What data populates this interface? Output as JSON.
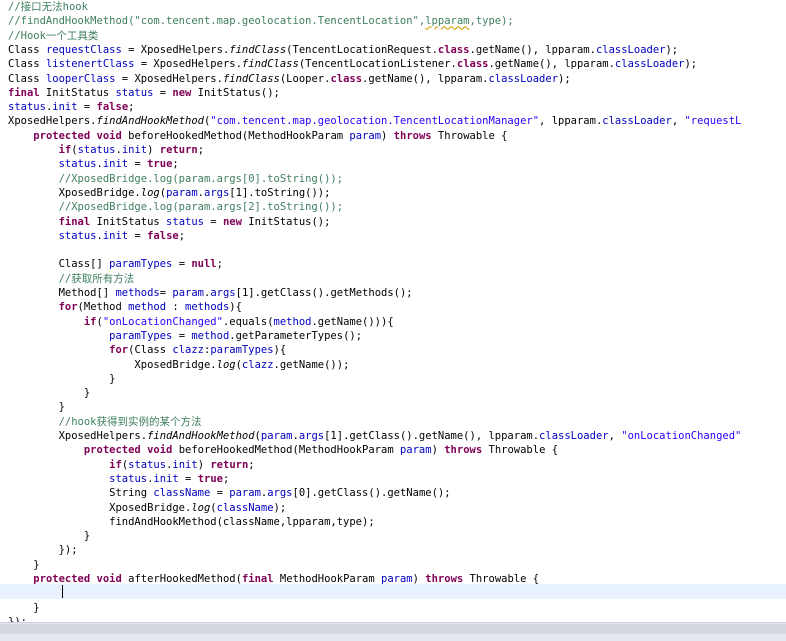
{
  "editor": {
    "lines": [
      [
        {
          "t": "//接口无法hook",
          "c": "cmt"
        }
      ],
      [
        {
          "t": "//findAndHookMethod(\"com.tencent.map.geolocation.TencentLocation\",",
          "c": "cmt"
        },
        {
          "t": "lpparam",
          "c": "cmt und"
        },
        {
          "t": ",type);",
          "c": "cmt"
        }
      ],
      [
        {
          "t": "//Hook一个工具类",
          "c": "cmt"
        }
      ],
      [
        {
          "t": "Class "
        },
        {
          "t": "requestClass",
          "c": "fld"
        },
        {
          "t": " = XposedHelpers."
        },
        {
          "t": "findClass",
          "c": "itl"
        },
        {
          "t": "(TencentLocationRequest."
        },
        {
          "t": "class",
          "c": "kw"
        },
        {
          "t": ".getName(), lpparam."
        },
        {
          "t": "classLoader",
          "c": "fld"
        },
        {
          "t": ");"
        }
      ],
      [
        {
          "t": "Class "
        },
        {
          "t": "listenertClass",
          "c": "fld"
        },
        {
          "t": " = XposedHelpers."
        },
        {
          "t": "findClass",
          "c": "itl"
        },
        {
          "t": "(TencentLocationListener."
        },
        {
          "t": "class",
          "c": "kw"
        },
        {
          "t": ".getName(), lpparam."
        },
        {
          "t": "classLoader",
          "c": "fld"
        },
        {
          "t": ");"
        }
      ],
      [
        {
          "t": "Class "
        },
        {
          "t": "looperClass",
          "c": "fld"
        },
        {
          "t": " = XposedHelpers."
        },
        {
          "t": "findClass",
          "c": "itl"
        },
        {
          "t": "(Looper."
        },
        {
          "t": "class",
          "c": "kw"
        },
        {
          "t": ".getName(), lpparam."
        },
        {
          "t": "classLoader",
          "c": "fld"
        },
        {
          "t": ");"
        }
      ],
      [
        {
          "t": "final",
          "c": "kw"
        },
        {
          "t": " InitStatus "
        },
        {
          "t": "status",
          "c": "fld"
        },
        {
          "t": " = "
        },
        {
          "t": "new",
          "c": "kw"
        },
        {
          "t": " InitStatus();"
        }
      ],
      [
        {
          "t": "status",
          "c": "fld"
        },
        {
          "t": "."
        },
        {
          "t": "init",
          "c": "fld"
        },
        {
          "t": " = "
        },
        {
          "t": "false",
          "c": "kw"
        },
        {
          "t": ";"
        }
      ],
      [
        {
          "t": "XposedHelpers."
        },
        {
          "t": "findAndHookMethod",
          "c": "itl"
        },
        {
          "t": "("
        },
        {
          "t": "\"com.tencent.map.geolocation.TencentLocationManager\"",
          "c": "str"
        },
        {
          "t": ", lpparam."
        },
        {
          "t": "classLoader",
          "c": "fld"
        },
        {
          "t": ", "
        },
        {
          "t": "\"requestL",
          "c": "str"
        }
      ],
      [
        {
          "t": "    "
        },
        {
          "t": "protected",
          "c": "kw"
        },
        {
          "t": " "
        },
        {
          "t": "void",
          "c": "kw"
        },
        {
          "t": " beforeHookedMethod(MethodHookParam "
        },
        {
          "t": "param",
          "c": "fld"
        },
        {
          "t": ") "
        },
        {
          "t": "throws",
          "c": "kw"
        },
        {
          "t": " Throwable {"
        }
      ],
      [
        {
          "t": "        "
        },
        {
          "t": "if",
          "c": "kw"
        },
        {
          "t": "("
        },
        {
          "t": "status",
          "c": "fld"
        },
        {
          "t": "."
        },
        {
          "t": "init",
          "c": "fld"
        },
        {
          "t": ") "
        },
        {
          "t": "return",
          "c": "kw"
        },
        {
          "t": ";"
        }
      ],
      [
        {
          "t": "        "
        },
        {
          "t": "status",
          "c": "fld"
        },
        {
          "t": "."
        },
        {
          "t": "init",
          "c": "fld"
        },
        {
          "t": " = "
        },
        {
          "t": "true",
          "c": "kw"
        },
        {
          "t": ";"
        }
      ],
      [
        {
          "t": "        //XposedBridge.log(param.args[0].toString());",
          "c": "cmt"
        }
      ],
      [
        {
          "t": "        XposedBridge."
        },
        {
          "t": "log",
          "c": "itl"
        },
        {
          "t": "("
        },
        {
          "t": "param",
          "c": "fld"
        },
        {
          "t": "."
        },
        {
          "t": "args",
          "c": "fld"
        },
        {
          "t": "[1].toString());"
        }
      ],
      [
        {
          "t": "        //XposedBridge.log(param.args[2].toString());",
          "c": "cmt"
        }
      ],
      [
        {
          "t": "        "
        },
        {
          "t": "final",
          "c": "kw"
        },
        {
          "t": " InitStatus "
        },
        {
          "t": "status",
          "c": "fld"
        },
        {
          "t": " = "
        },
        {
          "t": "new",
          "c": "kw"
        },
        {
          "t": " InitStatus();"
        }
      ],
      [
        {
          "t": "        "
        },
        {
          "t": "status",
          "c": "fld"
        },
        {
          "t": "."
        },
        {
          "t": "init",
          "c": "fld"
        },
        {
          "t": " = "
        },
        {
          "t": "false",
          "c": "kw"
        },
        {
          "t": ";"
        }
      ],
      [
        {
          "t": ""
        }
      ],
      [
        {
          "t": "        Class[] "
        },
        {
          "t": "paramTypes",
          "c": "fld"
        },
        {
          "t": " = "
        },
        {
          "t": "null",
          "c": "kw"
        },
        {
          "t": ";"
        }
      ],
      [
        {
          "t": "        //获取所有方法",
          "c": "cmt"
        }
      ],
      [
        {
          "t": "        Method[] "
        },
        {
          "t": "methods",
          "c": "fld"
        },
        {
          "t": "= "
        },
        {
          "t": "param",
          "c": "fld"
        },
        {
          "t": "."
        },
        {
          "t": "args",
          "c": "fld"
        },
        {
          "t": "[1].getClass().getMethods();"
        }
      ],
      [
        {
          "t": "        "
        },
        {
          "t": "for",
          "c": "kw"
        },
        {
          "t": "(Method "
        },
        {
          "t": "method",
          "c": "fld"
        },
        {
          "t": " : "
        },
        {
          "t": "methods",
          "c": "fld"
        },
        {
          "t": "){"
        }
      ],
      [
        {
          "t": "            "
        },
        {
          "t": "if",
          "c": "kw"
        },
        {
          "t": "("
        },
        {
          "t": "\"onLocationChanged\"",
          "c": "str"
        },
        {
          "t": ".equals("
        },
        {
          "t": "method",
          "c": "fld"
        },
        {
          "t": ".getName())){"
        }
      ],
      [
        {
          "t": "                "
        },
        {
          "t": "paramTypes",
          "c": "fld"
        },
        {
          "t": " = "
        },
        {
          "t": "method",
          "c": "fld"
        },
        {
          "t": ".getParameterTypes();"
        }
      ],
      [
        {
          "t": "                "
        },
        {
          "t": "for",
          "c": "kw"
        },
        {
          "t": "(Class "
        },
        {
          "t": "clazz",
          "c": "fld"
        },
        {
          "t": ":"
        },
        {
          "t": "paramTypes",
          "c": "fld"
        },
        {
          "t": "){"
        }
      ],
      [
        {
          "t": "                    XposedBridge."
        },
        {
          "t": "log",
          "c": "itl"
        },
        {
          "t": "("
        },
        {
          "t": "clazz",
          "c": "fld"
        },
        {
          "t": ".getName());"
        }
      ],
      [
        {
          "t": "                }"
        }
      ],
      [
        {
          "t": "            }"
        }
      ],
      [
        {
          "t": "        }"
        }
      ],
      [
        {
          "t": "        //hook获得到实例的某个方法",
          "c": "cmt"
        }
      ],
      [
        {
          "t": "        XposedHelpers."
        },
        {
          "t": "findAndHookMethod",
          "c": "itl"
        },
        {
          "t": "("
        },
        {
          "t": "param",
          "c": "fld"
        },
        {
          "t": "."
        },
        {
          "t": "args",
          "c": "fld"
        },
        {
          "t": "[1].getClass().getName(), lpparam."
        },
        {
          "t": "classLoader",
          "c": "fld"
        },
        {
          "t": ", "
        },
        {
          "t": "\"onLocationChanged\"",
          "c": "str"
        }
      ],
      [
        {
          "t": "            "
        },
        {
          "t": "protected",
          "c": "kw"
        },
        {
          "t": " "
        },
        {
          "t": "void",
          "c": "kw"
        },
        {
          "t": " beforeHookedMethod(MethodHookParam "
        },
        {
          "t": "param",
          "c": "fld"
        },
        {
          "t": ") "
        },
        {
          "t": "throws",
          "c": "kw"
        },
        {
          "t": " Throwable {"
        }
      ],
      [
        {
          "t": "                "
        },
        {
          "t": "if",
          "c": "kw"
        },
        {
          "t": "("
        },
        {
          "t": "status",
          "c": "fld"
        },
        {
          "t": "."
        },
        {
          "t": "init",
          "c": "fld"
        },
        {
          "t": ") "
        },
        {
          "t": "return",
          "c": "kw"
        },
        {
          "t": ";"
        }
      ],
      [
        {
          "t": "                "
        },
        {
          "t": "status",
          "c": "fld"
        },
        {
          "t": "."
        },
        {
          "t": "init",
          "c": "fld"
        },
        {
          "t": " = "
        },
        {
          "t": "true",
          "c": "kw"
        },
        {
          "t": ";"
        }
      ],
      [
        {
          "t": "                String "
        },
        {
          "t": "className",
          "c": "fld"
        },
        {
          "t": " = "
        },
        {
          "t": "param",
          "c": "fld"
        },
        {
          "t": "."
        },
        {
          "t": "args",
          "c": "fld"
        },
        {
          "t": "[0].getClass().getName();"
        }
      ],
      [
        {
          "t": "                XposedBridge."
        },
        {
          "t": "log",
          "c": "itl"
        },
        {
          "t": "("
        },
        {
          "t": "className",
          "c": "fld"
        },
        {
          "t": ");"
        }
      ],
      [
        {
          "t": "                findAndHookMethod(className,lpparam,type);"
        }
      ],
      [
        {
          "t": "            }"
        }
      ],
      [
        {
          "t": "        });"
        }
      ],
      [
        {
          "t": "    }"
        }
      ],
      [
        {
          "t": "    "
        },
        {
          "t": "protected",
          "c": "kw"
        },
        {
          "t": " "
        },
        {
          "t": "void",
          "c": "kw"
        },
        {
          "t": " afterHookedMethod("
        },
        {
          "t": "final",
          "c": "kw"
        },
        {
          "t": " MethodHookParam "
        },
        {
          "t": "param",
          "c": "fld"
        },
        {
          "t": ") "
        },
        {
          "t": "throws",
          "c": "kw"
        },
        {
          "t": " Throwable {"
        }
      ],
      [
        {
          "t": ""
        }
      ],
      [
        {
          "t": "    }"
        }
      ],
      [
        {
          "t": "});"
        }
      ]
    ]
  },
  "colors": {
    "comment": "#3f7f5f",
    "keyword": "#7f0055",
    "field": "#0000c0",
    "string": "#2a00ff",
    "current_line": "#e8f2fe"
  }
}
